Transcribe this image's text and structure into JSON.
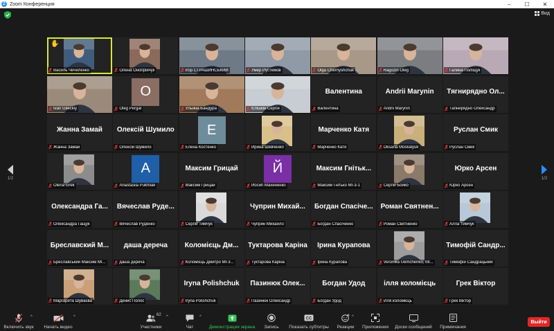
{
  "window": {
    "title": "Zoom Конференция",
    "app_icon": "Z"
  },
  "view": {
    "label": "Вид"
  },
  "nav": {
    "left_page": "1/2",
    "right_page": "1/2"
  },
  "participants": [
    {
      "name": "Василь Чичиленко",
      "kind": "photo",
      "photo": "center",
      "bg": "#3f5c7c",
      "active": true,
      "hand": true
    },
    {
      "name": "Олена Онопрійчук",
      "kind": "photo",
      "photo": "center",
      "bg": "#8a6a5a"
    },
    {
      "name": "Ігор СТРАШИНСЬКИЙ",
      "kind": "photo",
      "photo": "full",
      "bg": "#6e7a86"
    },
    {
      "name": "Умер Рустемов",
      "kind": "photo",
      "photo": "full",
      "bg": "#8f9aa6"
    },
    {
      "name": "Olga Chernyshchuk",
      "kind": "photo",
      "photo": "full",
      "bg": "#a89888"
    },
    {
      "name": "Ragozin Oleg",
      "kind": "photo",
      "photo": "full",
      "bg": "#7b7d80"
    },
    {
      "name": "Галина Поліщук",
      "kind": "photo",
      "photo": "full",
      "bg": "#b9a9b4"
    },
    {
      "name": "Ivan Gileckiy",
      "kind": "photo",
      "photo": "full",
      "bg": "#9a8a7a"
    },
    {
      "name": "Oleg Pergat",
      "kind": "initial",
      "initial": "O",
      "color": "#8a6e63"
    },
    {
      "name": "Ульяна Бандура",
      "kind": "photo",
      "photo": "full",
      "bg": "#a07a5a"
    },
    {
      "name": "Єлішкін Сергій",
      "kind": "photo",
      "photo": "full",
      "bg": "#c7cdd2"
    },
    {
      "name": "Валентина",
      "kind": "name",
      "big": "Валентина"
    },
    {
      "name": "Andrii Marynin",
      "kind": "name",
      "big": "Andrii Marynin"
    },
    {
      "name": "Тапнирядно Олександр",
      "kind": "name",
      "big": "Тягнирядно Ол..."
    },
    {
      "name": "Жанна Замай",
      "kind": "name",
      "big": "Жанна Замай"
    },
    {
      "name": "Олексій Шумило",
      "kind": "name",
      "big": "Олексій Шумило"
    },
    {
      "name": "Елена Костенко",
      "kind": "initial",
      "initial": "E",
      "color": "#6f8c9b"
    },
    {
      "name": "Ирина Шевченко",
      "kind": "photo",
      "photo": "center",
      "bg": "#d9c08a"
    },
    {
      "name": "Марченко Катя",
      "kind": "name",
      "big": "Марченко Катя"
    },
    {
      "name": "Oksana Moskalyuk",
      "kind": "photo",
      "photo": "center",
      "bg": "#c9b07a"
    },
    {
      "name": "Руслан Смик",
      "kind": "name",
      "big": "Руслан Смик"
    },
    {
      "name": "Olena Grek",
      "kind": "photo",
      "photo": "center",
      "bg": "#8c8c8c"
    },
    {
      "name": "Anastasiia Pukhliak",
      "kind": "initial",
      "initial": "A",
      "color": "#1f5fa8"
    },
    {
      "name": "Максим Грицай",
      "kind": "name",
      "big": "Максим Грицай"
    },
    {
      "name": "Йосип Махиненко",
      "kind": "initial",
      "initial": "Й",
      "color": "#7a2fa5"
    },
    {
      "name": "Максим Гнітько МІ-3-1",
      "kind": "name",
      "big": "Максим Гнітьк..."
    },
    {
      "name": "Сергій Бойко",
      "kind": "photo",
      "photo": "center",
      "bg": "#8a7a6a"
    },
    {
      "name": "Юрко Арсен",
      "kind": "name",
      "big": "Юрко Арсен"
    },
    {
      "name": "Олександра Гащук",
      "kind": "name",
      "big": "Олександра Га..."
    },
    {
      "name": "Вячеслав Руденко",
      "kind": "name",
      "big": "Вячеслав Руде..."
    },
    {
      "name": "Сергій Тимчук",
      "kind": "photo",
      "photo": "center",
      "bg": "#dadada"
    },
    {
      "name": "Чуприн Михайло",
      "kind": "name",
      "big": "Чуприн Михай..."
    },
    {
      "name": "Богдан Спасіченко",
      "kind": "name",
      "big": "Богдан Спасіче..."
    },
    {
      "name": "Роман Святненко",
      "kind": "name",
      "big": "Роман Святнен..."
    },
    {
      "name": "Алла Тимчук",
      "kind": "photo",
      "photo": "center",
      "bg": "#b8c8d8"
    },
    {
      "name": "Бреславський Максим МІ...",
      "kind": "name",
      "big": "Бреславский М..."
    },
    {
      "name": "даша дереча",
      "kind": "name",
      "big": "даша дереча"
    },
    {
      "name": "Коломієць Дмитро МІ-3...",
      "kind": "name",
      "big": "Коломієць Дм..."
    },
    {
      "name": "Туктарова Каріна",
      "kind": "name",
      "big": "Туктарова Каріна"
    },
    {
      "name": "Ірина Курапова",
      "kind": "name",
      "big": "Ірина Курапова"
    },
    {
      "name": "Veronika Uemchenko, MI...",
      "kind": "photo",
      "photo": "center",
      "bg": "#9c9c9c"
    },
    {
      "name": "Тимофій Сандрацький",
      "kind": "name",
      "big": "Тимофій Сандр..."
    },
    {
      "name": "Маргарита Шуваєва",
      "kind": "photo",
      "photo": "center",
      "bg": "#c9a078"
    },
    {
      "name": "Денис Полос",
      "kind": "photo",
      "photo": "center",
      "bg": "#5a7a5a"
    },
    {
      "name": "Iryna Polishchuk",
      "kind": "name",
      "big": "Iryna Polishchuk"
    },
    {
      "name": "Пазинюк Олександр",
      "kind": "name",
      "big": "Пазинюк Олек..."
    },
    {
      "name": "Богдан Удод",
      "kind": "name",
      "big": "Богдан Удод"
    },
    {
      "name": "ілля коломієць",
      "kind": "name",
      "big": "ілля коломієць"
    },
    {
      "name": "Грек Віктор",
      "kind": "name",
      "big": "Грек Віктор"
    }
  ],
  "toolbar": {
    "mute": "Включить звук",
    "video": "Начать видео",
    "participants": "Участники",
    "participants_count": "62",
    "chat": "Чат",
    "share": "Демонстрация экрана",
    "record": "Запись",
    "cc": "Показать субтитры",
    "reactions": "Реакции",
    "apps": "Приложения",
    "whiteboard": "Доски сообщений",
    "notes": "Примечания",
    "leave": "Выйти"
  },
  "colors": {
    "accent": "#2d8cff",
    "share_green": "#34c759",
    "leave_red": "#e02828",
    "active_border": "#d8e83c",
    "mic_red": "#e23b3b"
  }
}
